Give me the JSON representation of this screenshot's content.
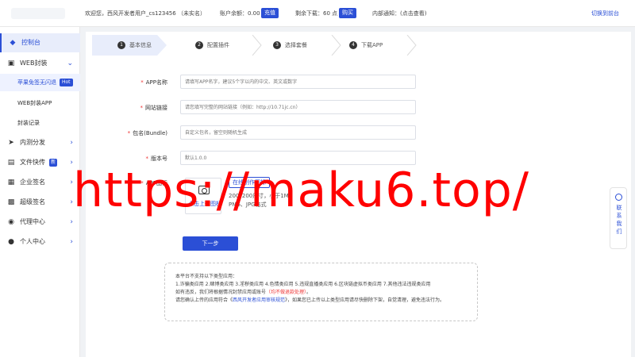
{
  "header": {
    "welcome": "欢迎您，西风开发者用户_cs123456 （未实名）",
    "balance_label": "账户余额：0.00",
    "recharge_label": "充值",
    "downloads_label": "剩余下载：60 点",
    "buy_label": "购买",
    "notice_label": "内部通知：(点击查看)",
    "switch_label": "切换到前台"
  },
  "sidebar": {
    "items": [
      {
        "label": "控制台",
        "icon": "cube-icon"
      },
      {
        "label": "WEB封装",
        "icon": "package-icon"
      },
      {
        "label": "内测分发",
        "icon": "send-icon"
      },
      {
        "label": "文件快传",
        "icon": "file-icon",
        "badge": "新"
      },
      {
        "label": "企业签名",
        "icon": "enterprise-icon"
      },
      {
        "label": "超级签名",
        "icon": "signature-icon"
      },
      {
        "label": "代理中心",
        "icon": "agent-icon"
      },
      {
        "label": "个人中心",
        "icon": "user-icon"
      }
    ],
    "subitems": [
      {
        "label": "苹果免签无闪退",
        "badge": "Hot"
      },
      {
        "label": "WEB封装APP"
      },
      {
        "label": "封装记录"
      }
    ]
  },
  "steps": [
    {
      "num": "1",
      "label": "基本信息"
    },
    {
      "num": "2",
      "label": "配置插件"
    },
    {
      "num": "3",
      "label": "选择套餐"
    },
    {
      "num": "4",
      "label": "下载APP"
    }
  ],
  "form": {
    "app_name": {
      "label": "APP名称",
      "placeholder": "请填写APP名字，建议5个字以内的中文、英文或数字"
    },
    "website": {
      "label": "网站链接",
      "placeholder": "请您填写完整的网站链接（例如：http://10.71jc.cn）"
    },
    "bundle": {
      "label": "包名(Bundle)",
      "placeholder": "自定义包名，留空则随机生成"
    },
    "version": {
      "label": "版本号",
      "placeholder": "默认1.0.0"
    },
    "icon": {
      "label": "APP图标",
      "upload_label": "点击上传图标",
      "online_label": "在线制作图标",
      "hint": "200*200尺寸，小于1M PNG、JPG格式"
    },
    "next_label": "下一步"
  },
  "notice": {
    "line1": "本平台不支持以下类型应用：",
    "line2": "1.诈骗类应用 2.赌博类应用 3.淫秽类应用 4.色情类应用 5.违规直播类应用 6.区块链虚拟币类应用 7.其他违法违规类应用",
    "line3_a": "如有违反，我们将根据情况封禁应用或账号",
    "line3_b": "（均不做退款处理）",
    "line3_c": "。",
    "line4_a": "请您确认上传的应用符合《",
    "line4_b": "西风开发者应用审核规范",
    "line4_c": "》，如果您已上传以上类型应用请尽快删除下架，自觉清理，避免违法行为。"
  },
  "contact": {
    "label": "联系我们"
  },
  "watermark": "https://maku6.top/",
  "colors": {
    "accent": "#2b4fd6",
    "required": "#e33333",
    "watermark": "#ff0000"
  }
}
